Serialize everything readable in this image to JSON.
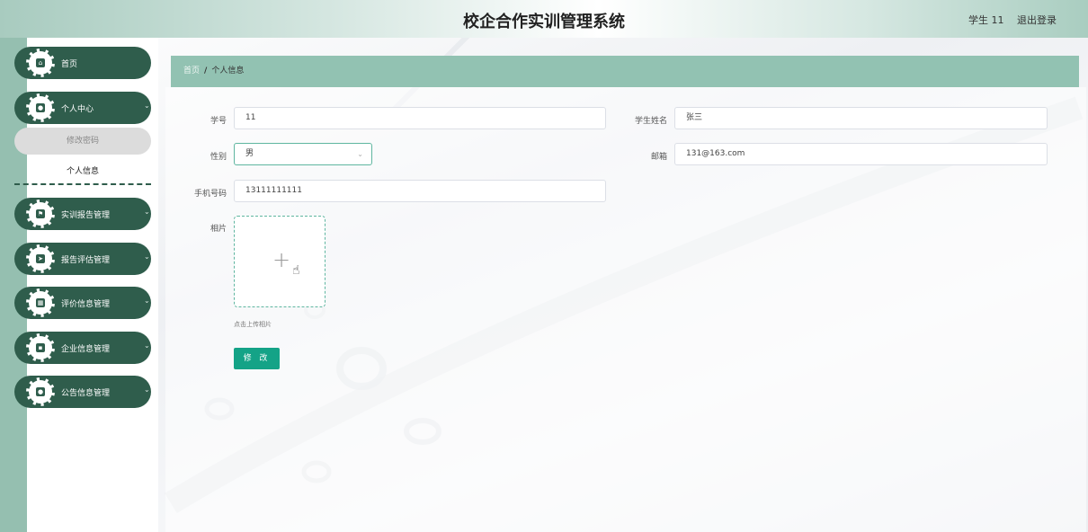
{
  "header": {
    "title": "校企合作实训管理系统",
    "user": "学生 11",
    "logout": "退出登录"
  },
  "sidebar": {
    "items": [
      {
        "label": "首页",
        "icon": "home-icon",
        "has_children": false
      },
      {
        "label": "个人中心",
        "icon": "user-icon",
        "has_children": true,
        "expanded": true,
        "children": [
          {
            "label": "修改密码",
            "active": true
          },
          {
            "label": "个人信息",
            "active": false
          }
        ]
      },
      {
        "label": "实训报告管理",
        "icon": "flag-icon",
        "has_children": true
      },
      {
        "label": "报告评估管理",
        "icon": "send-icon",
        "has_children": true
      },
      {
        "label": "评价信息管理",
        "icon": "chart-icon",
        "has_children": true
      },
      {
        "label": "企业信息管理",
        "icon": "grid-icon",
        "has_children": true
      },
      {
        "label": "公告信息管理",
        "icon": "person-icon",
        "has_children": true
      }
    ]
  },
  "breadcrumb": {
    "home": "首页",
    "separator": "/",
    "current": "个人信息"
  },
  "form": {
    "student_id": {
      "label": "学号",
      "value": "11"
    },
    "student_name": {
      "label": "学生姓名",
      "value": "张三"
    },
    "gender": {
      "label": "性别",
      "value": "男"
    },
    "email": {
      "label": "邮箱",
      "value": "131@163.com"
    },
    "phone": {
      "label": "手机号码",
      "value": "13111111111"
    },
    "photo": {
      "label": "相片",
      "hint": "点击上传相片"
    },
    "submit_label": "修 改"
  },
  "colors": {
    "sidebar_item_bg": "#2f5d4c",
    "breadcrumb_bg": "#92c2b2",
    "button_bg": "#14a387",
    "left_stripe": "#95bfb0"
  }
}
